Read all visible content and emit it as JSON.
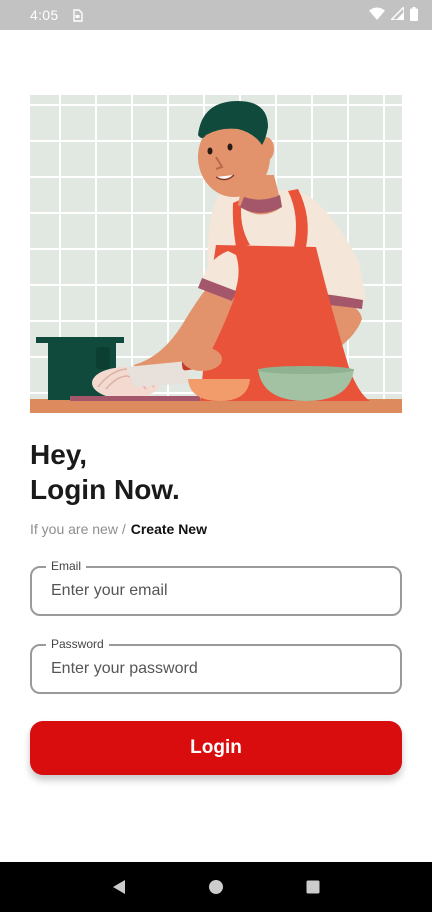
{
  "status_bar": {
    "time": "4:05"
  },
  "hero": {
    "image": "chef-cutting-onion-illustration"
  },
  "heading": {
    "line1": "Hey,",
    "line2": "Login Now."
  },
  "signup": {
    "prompt": "If you are new /",
    "link": "Create New"
  },
  "email": {
    "label": "Email",
    "placeholder": "Enter your email",
    "value": ""
  },
  "password": {
    "label": "Password",
    "placeholder": "Enter your password",
    "value": ""
  },
  "login_button": {
    "label": "Login"
  },
  "colors": {
    "accent": "#d90d0d",
    "status_bar": "#c2c2c2",
    "nav_bar": "#000000"
  },
  "icons": {
    "status": [
      "sim-icon",
      "wifi-icon",
      "signal-icon",
      "battery-icon"
    ],
    "nav": [
      "back-icon",
      "home-icon",
      "recents-icon"
    ]
  }
}
